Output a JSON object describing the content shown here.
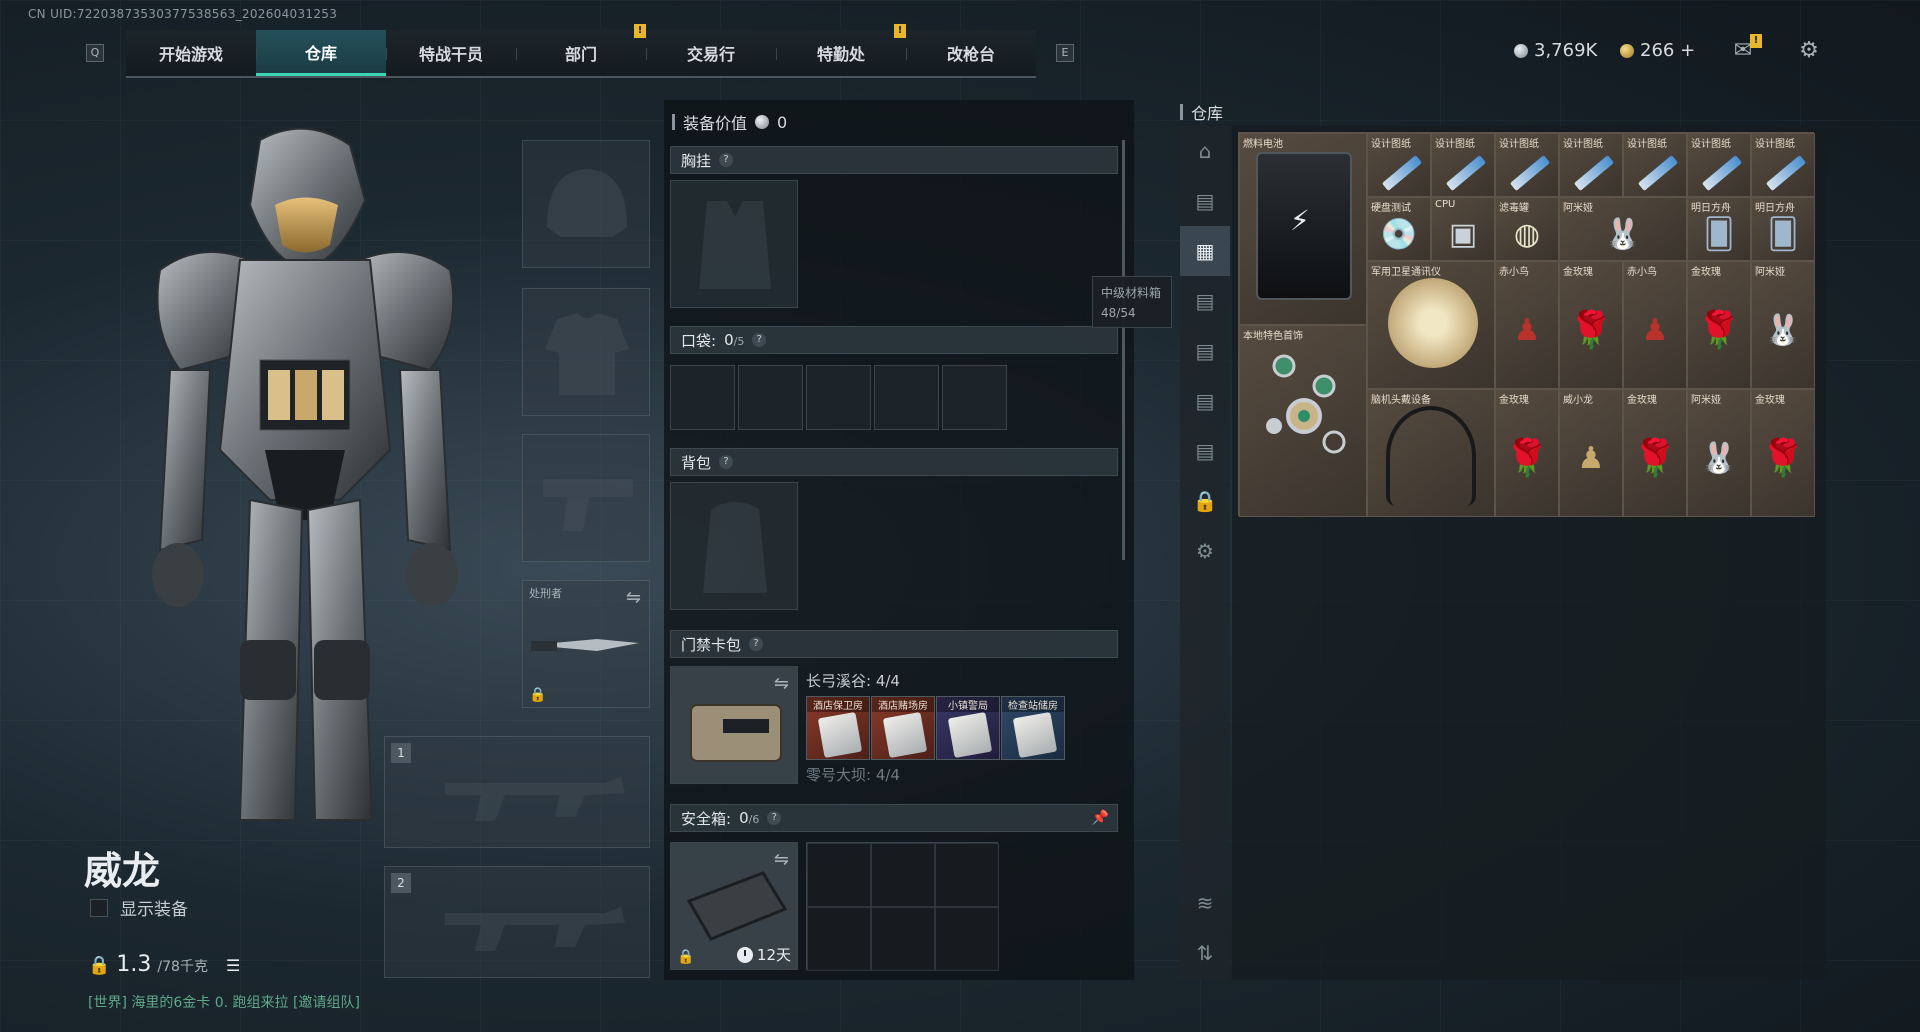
{
  "uid": "CN UID:7220387353037753856З_202604031253",
  "nav": {
    "key_left": "Q",
    "key_right": "E",
    "tabs": [
      {
        "label": "开始游戏",
        "active": false,
        "alert": false
      },
      {
        "label": "仓库",
        "active": true,
        "alert": false
      },
      {
        "label": "特战干员",
        "active": false,
        "alert": false
      },
      {
        "label": "部门",
        "active": false,
        "alert": true
      },
      {
        "label": "交易行",
        "active": false,
        "alert": false
      },
      {
        "label": "特勤处",
        "active": false,
        "alert": true
      },
      {
        "label": "改枪台",
        "active": false,
        "alert": false
      }
    ],
    "alert_glyph": "!"
  },
  "currency": {
    "silver": "3,769K",
    "gold": "266 +"
  },
  "character": {
    "name": "威龙",
    "show_gear_label": "显示装备",
    "weight_value": "1.3",
    "weight_max": "/78千克"
  },
  "world_chat": "[世界] 海里的6金卡 0. 跑组来拉  [邀请组队]",
  "equip_slots": {
    "melee_label": "处刑者",
    "weapon_slot_1": "1",
    "weapon_slot_2": "2"
  },
  "loadout": {
    "equip_value_label": "装备价值",
    "equip_value": "0",
    "chest_rig_label": "胸挂",
    "pockets_label": "口袋:",
    "pockets_used": "0",
    "pockets_total": "/5",
    "backpack_label": "背包",
    "keycard_label": "门禁卡包",
    "keycard_group_1": "长弓溪谷: 4/4",
    "keycard_group_2": "零号大坝: 4/4",
    "keycards": [
      "酒店保卫房",
      "酒店赌场房",
      "小镇警局",
      "检查站储房"
    ],
    "safebox_label": "安全箱:",
    "safebox_used": "0",
    "safebox_total": "/6",
    "safebox_timer": "12天",
    "help_glyph": "?"
  },
  "tooltip": {
    "title": "中级材料箱",
    "count": "48/54"
  },
  "warehouse": {
    "title": "仓库",
    "items": [
      {
        "label": "燃料电池",
        "kind": "battery"
      },
      {
        "label": "设计图纸",
        "kind": "blueprint"
      },
      {
        "label": "设计图纸",
        "kind": "blueprint"
      },
      {
        "label": "设计图纸",
        "kind": "blueprint"
      },
      {
        "label": "设计图纸",
        "kind": "blueprint"
      },
      {
        "label": "设计图纸",
        "kind": "blueprint"
      },
      {
        "label": "设计图纸",
        "kind": "blueprint"
      },
      {
        "label": "设计图纸",
        "kind": "blueprint"
      },
      {
        "label": "硬盘测试",
        "kind": "disk"
      },
      {
        "label": "CPU",
        "kind": "cpu"
      },
      {
        "label": "滤毒罐",
        "kind": "canister"
      },
      {
        "label": "阿米娅",
        "kind": "figure"
      },
      {
        "label": "明日方舟",
        "kind": "card"
      },
      {
        "label": "明日方舟",
        "kind": "card"
      },
      {
        "label": "军用卫星通讯仪",
        "kind": "satellite"
      },
      {
        "label": "赤小鸟",
        "kind": "figure-red"
      },
      {
        "label": "金玫瑰",
        "kind": "rose"
      },
      {
        "label": "赤小鸟",
        "kind": "figure-red"
      },
      {
        "label": "金玫瑰",
        "kind": "rose"
      },
      {
        "label": "阿米娅",
        "kind": "figure"
      },
      {
        "label": "本地特色首饰",
        "kind": "necklace"
      },
      {
        "label": "脑机头戴设备",
        "kind": "headset"
      },
      {
        "label": "金玫瑰",
        "kind": "rose"
      },
      {
        "label": "威小龙",
        "kind": "figure-gold"
      },
      {
        "label": "金玫瑰",
        "kind": "rose"
      },
      {
        "label": "阿米娅",
        "kind": "figure"
      },
      {
        "label": "金玫瑰",
        "kind": "rose"
      }
    ]
  },
  "colors": {
    "accent": "#38d6b4",
    "alert": "#e8b82a",
    "item_bg": "#4a4036"
  }
}
